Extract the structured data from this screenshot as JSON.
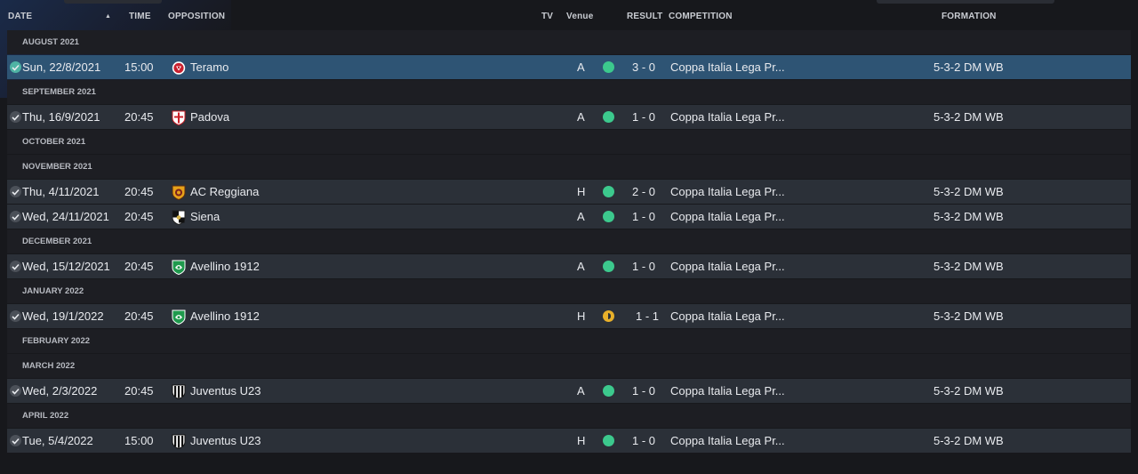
{
  "header": {
    "date": "DATE",
    "time": "TIME",
    "opposition": "OPPOSITION",
    "tv": "TV",
    "venue": "Venue",
    "result": "RESULT",
    "competition": "COMPETITION",
    "formation": "FORMATION"
  },
  "colors": {
    "win": "#3cc98d",
    "draw": "#e8b02a",
    "selected_row": "#2e5474",
    "row": "#2b3038"
  },
  "groups": [
    {
      "month": "AUGUST 2021",
      "matches": [
        {
          "date": "Sun, 22/8/2021",
          "time": "15:00",
          "opponent": "Teramo",
          "crest": "teramo-crest-icon",
          "venue": "A",
          "outcome": "win",
          "score": "3 - 0",
          "competition": "Coppa Italia Lega Pr...",
          "formation": "5-3-2 DM WB",
          "selected": true
        }
      ]
    },
    {
      "month": "SEPTEMBER 2021",
      "matches": [
        {
          "date": "Thu, 16/9/2021",
          "time": "20:45",
          "opponent": "Padova",
          "crest": "padova-crest-icon",
          "venue": "A",
          "outcome": "win",
          "score": "1 - 0",
          "competition": "Coppa Italia Lega Pr...",
          "formation": "5-3-2 DM WB",
          "selected": false
        }
      ]
    },
    {
      "month": "OCTOBER 2021",
      "matches": []
    },
    {
      "month": "NOVEMBER 2021",
      "matches": [
        {
          "date": "Thu, 4/11/2021",
          "time": "20:45",
          "opponent": "AC Reggiana",
          "crest": "reggiana-crest-icon",
          "venue": "H",
          "outcome": "win",
          "score": "2 - 0",
          "competition": "Coppa Italia Lega Pr...",
          "formation": "5-3-2 DM WB",
          "selected": false
        },
        {
          "date": "Wed, 24/11/2021",
          "time": "20:45",
          "opponent": "Siena",
          "crest": "siena-crest-icon",
          "venue": "A",
          "outcome": "win",
          "score": "1 - 0",
          "competition": "Coppa Italia Lega Pr...",
          "formation": "5-3-2 DM WB",
          "selected": false
        }
      ]
    },
    {
      "month": "DECEMBER 2021",
      "matches": [
        {
          "date": "Wed, 15/12/2021",
          "time": "20:45",
          "opponent": "Avellino 1912",
          "crest": "avellino-crest-icon",
          "venue": "A",
          "outcome": "win",
          "score": "1 - 0",
          "competition": "Coppa Italia Lega Pr...",
          "formation": "5-3-2 DM WB",
          "selected": false
        }
      ]
    },
    {
      "month": "JANUARY 2022",
      "matches": [
        {
          "date": "Wed, 19/1/2022",
          "time": "20:45",
          "opponent": "Avellino 1912",
          "crest": "avellino-crest-icon",
          "venue": "H",
          "outcome": "draw",
          "score": "1 - 1",
          "competition": "Coppa Italia Lega Pr...",
          "formation": "5-3-2 DM WB",
          "selected": false
        }
      ]
    },
    {
      "month": "FEBRUARY 2022",
      "matches": []
    },
    {
      "month": "MARCH 2022",
      "matches": [
        {
          "date": "Wed, 2/3/2022",
          "time": "20:45",
          "opponent": "Juventus U23",
          "crest": "juventus-crest-icon",
          "venue": "A",
          "outcome": "win",
          "score": "1 - 0",
          "competition": "Coppa Italia Lega Pr...",
          "formation": "5-3-2 DM WB",
          "selected": false
        }
      ]
    },
    {
      "month": "APRIL 2022",
      "matches": [
        {
          "date": "Tue, 5/4/2022",
          "time": "15:00",
          "opponent": "Juventus U23",
          "crest": "juventus-crest-icon",
          "venue": "H",
          "outcome": "win",
          "score": "1 - 0",
          "competition": "Coppa Italia Lega Pr...",
          "formation": "5-3-2 DM WB",
          "selected": false
        }
      ]
    }
  ]
}
